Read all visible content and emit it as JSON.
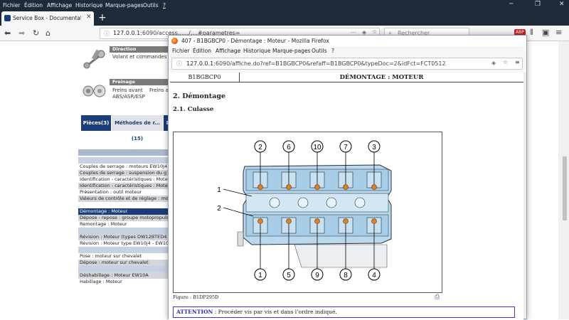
{
  "outer": {
    "menu": [
      "Fichier",
      "Édition",
      "Affichage",
      "Historique",
      "Marque-pages",
      "Outils",
      "?"
    ],
    "tab_title": "Service Box - Documentation T",
    "url_host": "127.0.0.1",
    "url_rest": ":6090/access....../....#parametres=",
    "search_placeholder": "Rechercher"
  },
  "background": {
    "categories": [
      {
        "name": "Direction",
        "desc": "Volant et commandes s"
      },
      {
        "name": "Freinage",
        "desc_a": "Freins avant",
        "desc_b": "Freins a",
        "desc_c": "ABS/ASR/ESP"
      }
    ],
    "tabs": [
      {
        "label": "Pièces(3)",
        "active": true
      },
      {
        "label": "Méthodes de r...(15)",
        "active": false
      },
      {
        "label": "I",
        "active": false
      }
    ],
    "rows": [
      {
        "text": "",
        "style": "hd"
      },
      {
        "text": "",
        "style": "ltb"
      },
      {
        "text": "Couples de serrage : moteurs EW10J4",
        "style": "w"
      },
      {
        "text": "Couples de serrage : suspension du g",
        "style": "g"
      },
      {
        "text": "Identification - caractéristiques : Moteur",
        "style": "w"
      },
      {
        "text": "Identification - caractéristiques : Moteur",
        "style": "g"
      },
      {
        "text": "Présentation : outil moteur",
        "style": "w"
      },
      {
        "text": "Valeurs de contrôle et de réglage : moto",
        "style": "g"
      },
      {
        "text": "",
        "style": "w"
      },
      {
        "text": "Démontage : Moteur",
        "style": "sel"
      },
      {
        "text": "Dépose - repose : groupe motopropuls",
        "style": "g"
      },
      {
        "text": "Remontage : Moteur",
        "style": "w"
      },
      {
        "text": "",
        "style": "ltb"
      },
      {
        "text": "Révision : Moteur (types DW12BTED4",
        "style": "g"
      },
      {
        "text": "Révision : Moteur type EW10j4 - EW10",
        "style": "w"
      },
      {
        "text": "",
        "style": "ltb"
      },
      {
        "text": "Pose : moteur sur chevalet",
        "style": "w"
      },
      {
        "text": "Dépose : moteur sur chevalet",
        "style": "g"
      },
      {
        "text": "",
        "style": "ltb"
      },
      {
        "text": "Déshabillage : Moteur EW10A",
        "style": "g"
      },
      {
        "text": "Habillage : Moteur",
        "style": "w"
      }
    ]
  },
  "popup": {
    "title": "407 - B1BGBCP0 - Démontage : Moteur - Mozilla Firefox",
    "menu": [
      "Fichier",
      "Édition",
      "Affichage",
      "Historique",
      "Marque-pages",
      "Outils",
      "?"
    ],
    "url_host": "127.0.0.1",
    "url_rest": ":6090/affiche.do?ref=B1BGBCP0&refaff=B1BGBCP0&typeDoc=2&idFct=FCT0512",
    "doc_code": "B1BGBCP0",
    "doc_title": "DÉMONTAGE : MOTEUR",
    "section": "2. Démontage",
    "subsection": "2.1. Culasse",
    "figure_caption": "Figure : B1DP295D",
    "callouts_top": [
      "2",
      "6",
      "10",
      "7",
      "3"
    ],
    "callouts_bottom": [
      "1",
      "5",
      "9",
      "8",
      "4"
    ],
    "side_labels": [
      "1",
      "2"
    ],
    "attention_label": "ATTENTION",
    "attention_text": " : Procéder vis par vis et dans l’ordre indiqué."
  }
}
